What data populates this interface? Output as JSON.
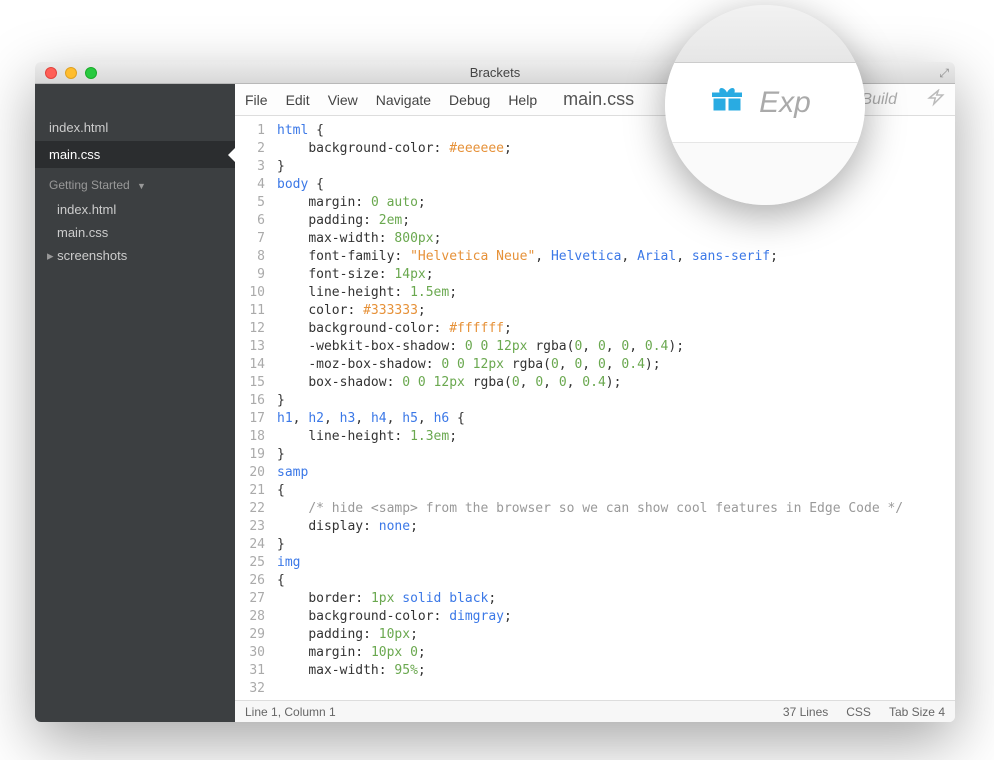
{
  "window": {
    "title": "Brackets"
  },
  "sidebar": {
    "working_files": [
      {
        "name": "index.html",
        "active": false
      },
      {
        "name": "main.css",
        "active": true
      }
    ],
    "project_name": "Getting Started",
    "tree": [
      {
        "name": "index.html",
        "type": "file"
      },
      {
        "name": "main.css",
        "type": "file"
      },
      {
        "name": "screenshots",
        "type": "folder"
      }
    ]
  },
  "menubar": {
    "items": [
      "File",
      "Edit",
      "View",
      "Navigate",
      "Debug",
      "Help"
    ],
    "current_file": "main.css",
    "build_label": "tal Build"
  },
  "code_lines": [
    [
      [
        "sel",
        "html"
      ],
      [
        "",
        ": {"
      ]
    ],
    [
      [
        "",
        "    "
      ],
      [
        "prop",
        "background-color"
      ],
      [
        "",
        ": "
      ],
      [
        "hex",
        "#eeeeee"
      ],
      [
        "",
        ";"
      ]
    ],
    [
      [
        "",
        "}"
      ]
    ],
    [
      [
        "",
        ""
      ]
    ],
    [
      [
        "sel",
        "body"
      ],
      [
        "",
        ": {"
      ]
    ],
    [
      [
        "",
        "    "
      ],
      [
        "prop",
        "margin"
      ],
      [
        "",
        ": "
      ],
      [
        "num",
        "0 auto"
      ],
      [
        "",
        ";"
      ]
    ],
    [
      [
        "",
        "    "
      ],
      [
        "prop",
        "padding"
      ],
      [
        "",
        ": "
      ],
      [
        "num",
        "2em"
      ],
      [
        "",
        ";"
      ]
    ],
    [
      [
        "",
        "    "
      ],
      [
        "prop",
        "max-width"
      ],
      [
        "",
        ": "
      ],
      [
        "num",
        "800px"
      ],
      [
        "",
        ";"
      ]
    ],
    [
      [
        "",
        "    "
      ],
      [
        "prop",
        "font-family"
      ],
      [
        "",
        ": "
      ],
      [
        "str",
        "\"Helvetica Neue\""
      ],
      [
        "",
        ", "
      ],
      [
        "id",
        "Helvetica"
      ],
      [
        "",
        ", "
      ],
      [
        "id",
        "Arial"
      ],
      [
        "",
        ", "
      ],
      [
        "id",
        "sans-serif"
      ],
      [
        "",
        ";"
      ]
    ],
    [
      [
        "",
        "    "
      ],
      [
        "prop",
        "font-size"
      ],
      [
        "",
        ": "
      ],
      [
        "num",
        "14px"
      ],
      [
        "",
        ";"
      ]
    ],
    [
      [
        "",
        "    "
      ],
      [
        "prop",
        "line-height"
      ],
      [
        "",
        ": "
      ],
      [
        "num",
        "1.5em"
      ],
      [
        "",
        ";"
      ]
    ],
    [
      [
        "",
        "    "
      ],
      [
        "prop",
        "color"
      ],
      [
        "",
        ": "
      ],
      [
        "hex",
        "#333333"
      ],
      [
        "",
        ";"
      ]
    ],
    [
      [
        "",
        "    "
      ],
      [
        "prop",
        "background-color"
      ],
      [
        "",
        ": "
      ],
      [
        "hex",
        "#ffffff"
      ],
      [
        "",
        ";"
      ]
    ],
    [
      [
        "",
        "    "
      ],
      [
        "prop",
        "-webkit-box-shadow"
      ],
      [
        "",
        ": "
      ],
      [
        "num",
        "0 0 12px"
      ],
      [
        "",
        ": "
      ],
      [
        "func",
        "rgba"
      ],
      [
        "",
        "("
      ],
      [
        "num",
        "0"
      ],
      [
        "",
        ", "
      ],
      [
        "num",
        "0"
      ],
      [
        "",
        ", "
      ],
      [
        "num",
        "0"
      ],
      [
        "",
        ", "
      ],
      [
        "num",
        "0.4"
      ],
      [
        "",
        ");"
      ]
    ],
    [
      [
        "",
        "    "
      ],
      [
        "prop",
        "-moz-box-shadow"
      ],
      [
        "",
        ": "
      ],
      [
        "num",
        "0 0 12px"
      ],
      [
        "",
        ": "
      ],
      [
        "func",
        "rgba"
      ],
      [
        "",
        "("
      ],
      [
        "num",
        "0"
      ],
      [
        "",
        ", "
      ],
      [
        "num",
        "0"
      ],
      [
        "",
        ", "
      ],
      [
        "num",
        "0"
      ],
      [
        "",
        ", "
      ],
      [
        "num",
        "0.4"
      ],
      [
        "",
        ");"
      ]
    ],
    [
      [
        "",
        "    "
      ],
      [
        "prop",
        "box-shadow"
      ],
      [
        "",
        ": "
      ],
      [
        "num",
        "0 0 12px"
      ],
      [
        "",
        ": "
      ],
      [
        "func",
        "rgba"
      ],
      [
        "",
        "("
      ],
      [
        "num",
        "0"
      ],
      [
        "",
        ", "
      ],
      [
        "num",
        "0"
      ],
      [
        "",
        ", "
      ],
      [
        "num",
        "0"
      ],
      [
        "",
        ", "
      ],
      [
        "num",
        "0.4"
      ],
      [
        "",
        ");"
      ]
    ],
    [
      [
        "",
        "}"
      ]
    ],
    [
      [
        "",
        ""
      ]
    ],
    [
      [
        "sel",
        "h1"
      ],
      [
        "",
        ", "
      ],
      [
        "sel",
        "h2"
      ],
      [
        "",
        ", "
      ],
      [
        "sel",
        "h3"
      ],
      [
        "",
        ", "
      ],
      [
        "sel",
        "h4"
      ],
      [
        "",
        ", "
      ],
      [
        "sel",
        "h5"
      ],
      [
        "",
        ", "
      ],
      [
        "sel",
        "h6"
      ],
      [
        "",
        ": {"
      ]
    ],
    [
      [
        "",
        "    "
      ],
      [
        "prop",
        "line-height"
      ],
      [
        "",
        ": "
      ],
      [
        "num",
        "1.3em"
      ],
      [
        "",
        ";"
      ]
    ],
    [
      [
        "",
        "}"
      ]
    ],
    [
      [
        "",
        ""
      ]
    ],
    [
      [
        "sel",
        "samp"
      ]
    ],
    [
      [
        "",
        "{"
      ]
    ],
    [
      [
        "",
        "    "
      ],
      [
        "comment",
        "/* hide <samp> from the browser so we can show cool features in Edge Code */"
      ]
    ],
    [
      [
        "",
        "    "
      ],
      [
        "prop",
        "display"
      ],
      [
        "",
        ": "
      ],
      [
        "id",
        "none"
      ],
      [
        "",
        ";"
      ]
    ],
    [
      [
        "",
        "}"
      ]
    ],
    [
      [
        "",
        ""
      ]
    ],
    [
      [
        "sel",
        "img"
      ]
    ],
    [
      [
        "",
        "{"
      ]
    ],
    [
      [
        "",
        "    "
      ],
      [
        "prop",
        "border"
      ],
      [
        "",
        ": "
      ],
      [
        "num",
        "1px"
      ],
      [
        "",
        ": "
      ],
      [
        "id",
        "solid"
      ],
      [
        "",
        ": "
      ],
      [
        "id",
        "black"
      ],
      [
        "",
        ";"
      ]
    ],
    [
      [
        "",
        "    "
      ],
      [
        "prop",
        "background-color"
      ],
      [
        "",
        ": "
      ],
      [
        "id",
        "dimgray"
      ],
      [
        "",
        ";"
      ]
    ],
    [
      [
        "",
        "    "
      ],
      [
        "prop",
        "padding"
      ],
      [
        "",
        ": "
      ],
      [
        "num",
        "10px"
      ],
      [
        "",
        ";"
      ]
    ],
    [
      [
        "",
        "    "
      ],
      [
        "prop",
        "margin"
      ],
      [
        "",
        ": "
      ],
      [
        "num",
        "10px 0"
      ],
      [
        "",
        ";"
      ]
    ],
    [
      [
        "",
        "    "
      ],
      [
        "prop",
        "max-width"
      ],
      [
        "",
        ": "
      ],
      [
        "num",
        "95%"
      ],
      [
        "",
        ";"
      ]
    ]
  ],
  "statusbar": {
    "position": "Line 1, Column 1",
    "lines": "37 Lines",
    "mode": "CSS",
    "tab": "Tab Size  4"
  },
  "magnifier": {
    "label": "Exp"
  }
}
